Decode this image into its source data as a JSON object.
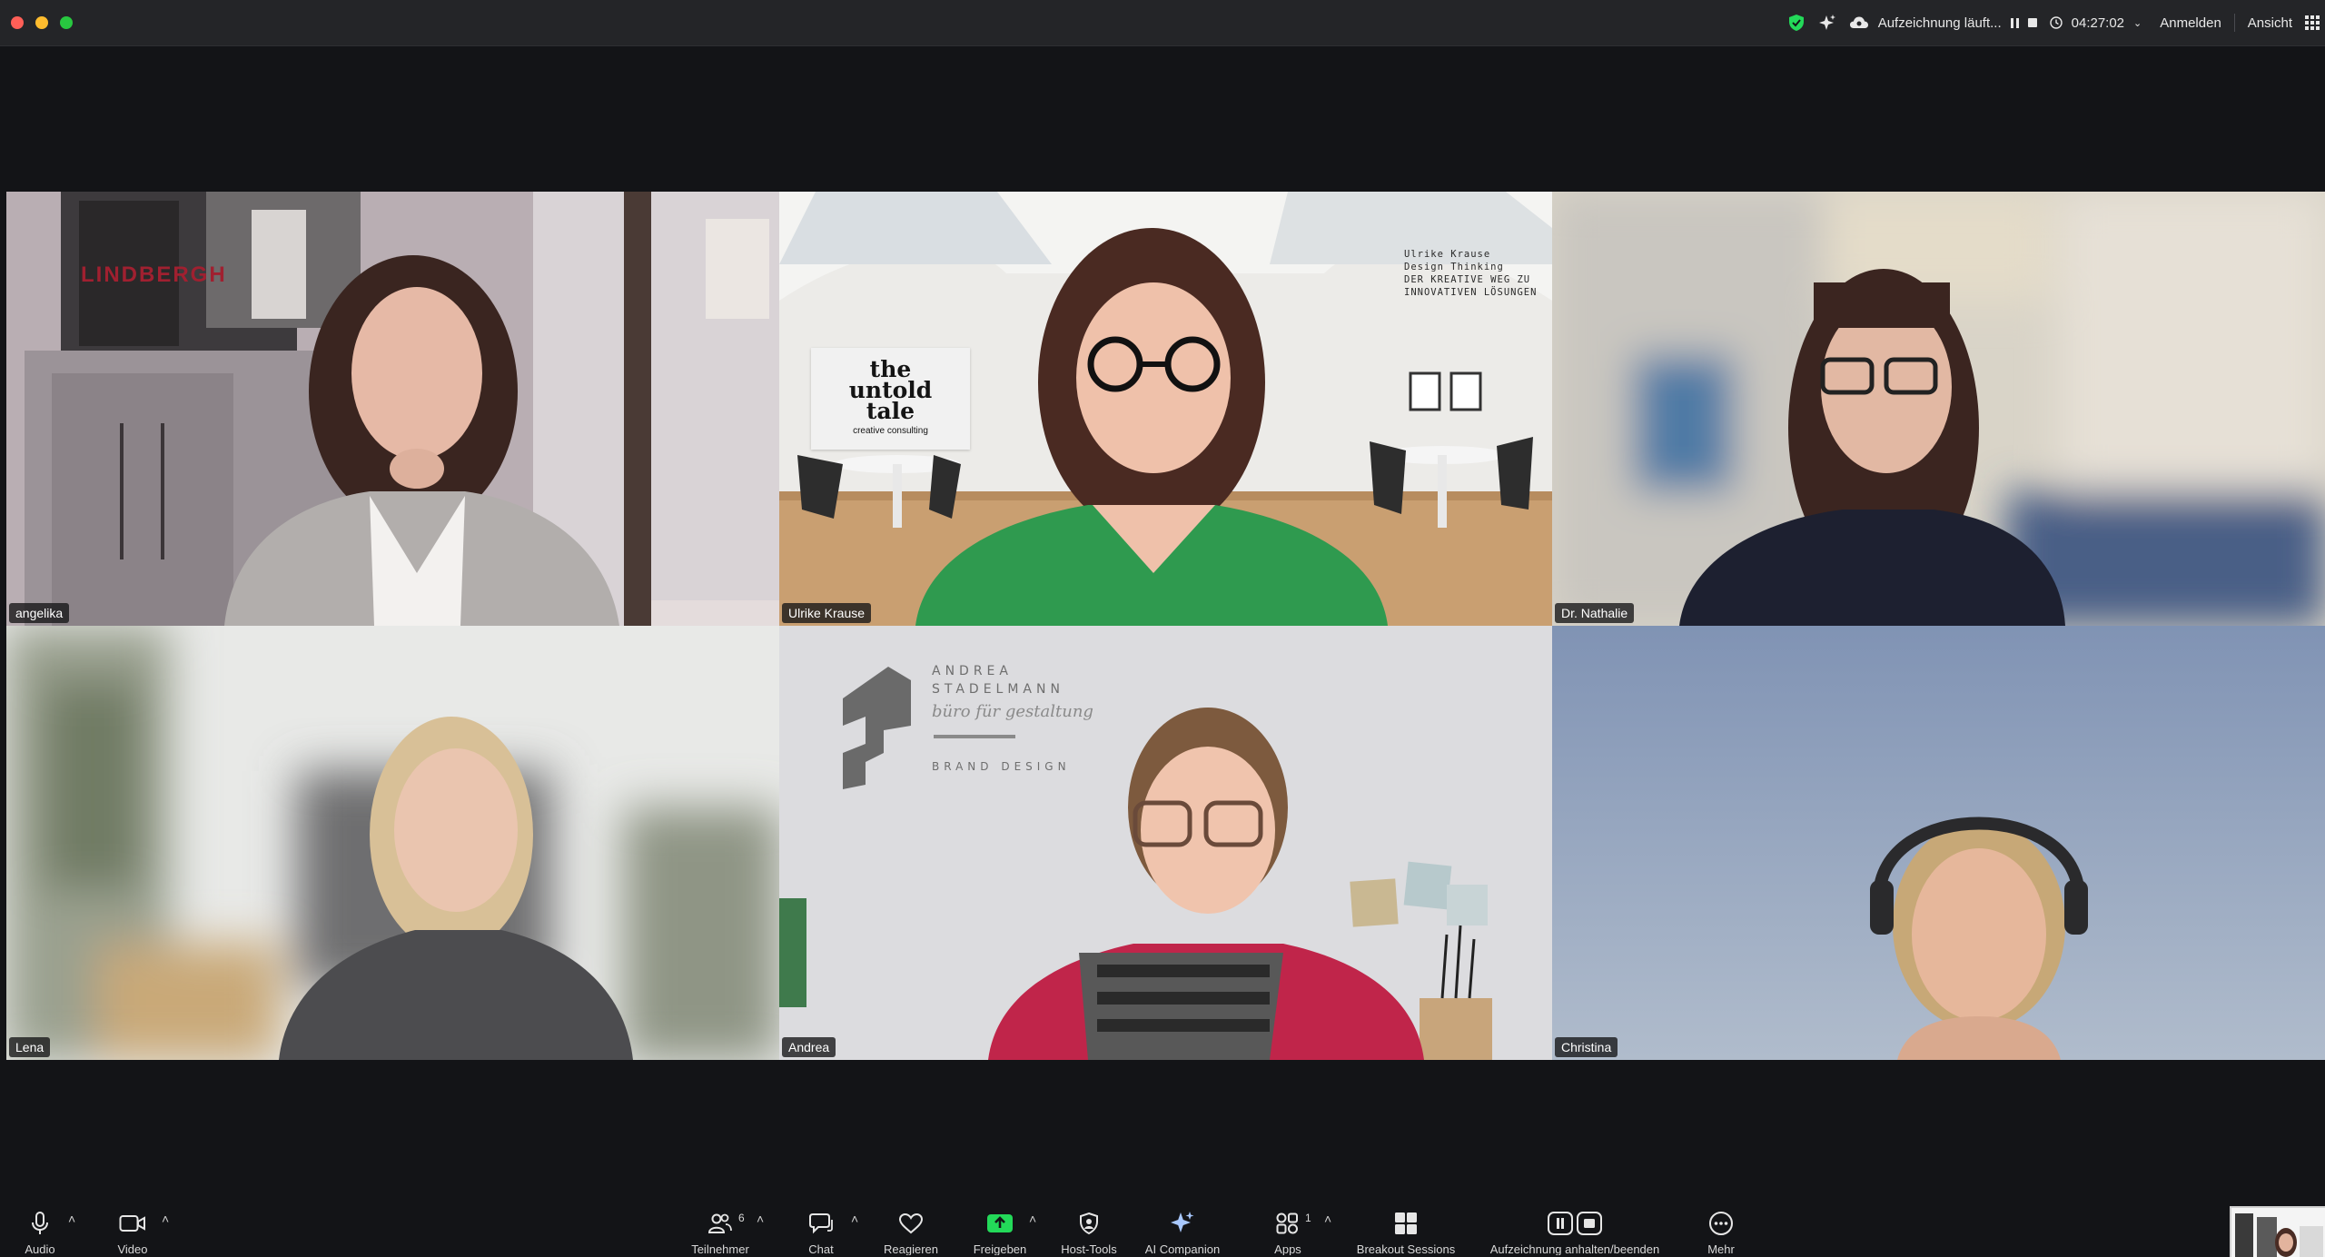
{
  "titlebar": {
    "recording_label": "Aufzeichnung läuft...",
    "timer": "04:27:02",
    "signin_label": "Anmelden",
    "view_label": "Ansicht"
  },
  "participants": [
    {
      "name": "angelika"
    },
    {
      "name": "Ulrike Krause"
    },
    {
      "name": "Dr. Nathalie"
    },
    {
      "name": "Lena"
    },
    {
      "name": "Andrea"
    },
    {
      "name": "Christina"
    }
  ],
  "backgrounds": {
    "poster_text": "LINDBERGH",
    "sign_untold": [
      "the",
      "untold",
      "tale"
    ],
    "sign_untold_sub": "creative consulting",
    "wall_text": [
      "Ulrike Krause",
      "Design Thinking",
      "DER KREATIVE WEG ZU",
      "INNOVATIVEN LÖSUNGEN"
    ],
    "brand_lines": [
      "ANDREA",
      "STADELMANN"
    ],
    "brand_script": "büro für gestaltung",
    "brand_design": "BRAND DESIGN"
  },
  "toolbar": {
    "audio": "Audio",
    "video": "Video",
    "participants": "Teilnehmer",
    "participants_count": "6",
    "chat": "Chat",
    "react": "Reagieren",
    "share": "Freigeben",
    "host_tools": "Host-Tools",
    "ai_companion": "AI Companion",
    "apps": "Apps",
    "apps_count": "1",
    "breakout": "Breakout Sessions",
    "recording": "Aufzeichnung anhalten/beenden",
    "more": "Mehr"
  },
  "colors": {
    "active_speaker": "#23d959",
    "share_green": "#23d959",
    "background": "#131417"
  }
}
